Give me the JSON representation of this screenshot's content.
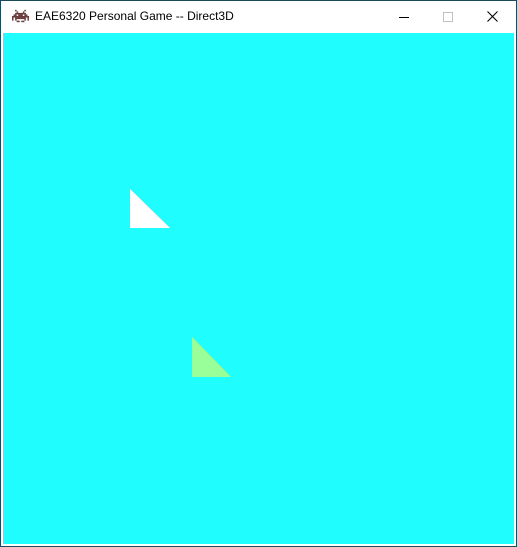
{
  "window": {
    "title": "EAE6320 Personal Game -- Direct3D",
    "icon": "space-invader-icon",
    "controls": {
      "minimize": "minimize-icon",
      "maximize": "maximize-icon",
      "close": "close-icon"
    }
  },
  "scene": {
    "background_color": "#1ffdff",
    "shapes": [
      {
        "name": "white-triangle",
        "color": "#ffffff"
      },
      {
        "name": "green-triangle",
        "color": "#99ff99"
      }
    ]
  }
}
